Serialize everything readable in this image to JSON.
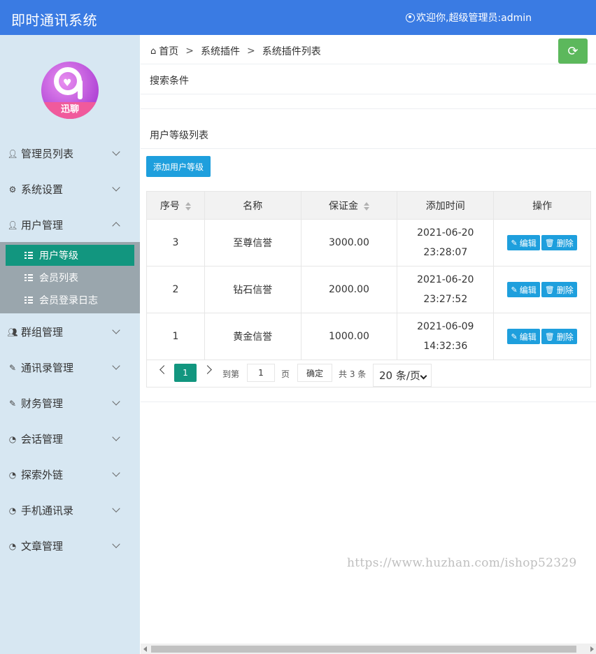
{
  "header": {
    "title": "即时通讯系统",
    "welcome": "欢迎你,超级管理员:admin"
  },
  "logo": {
    "text": "迅聊"
  },
  "sidebar": {
    "items": [
      {
        "label": "管理员列表",
        "icon": "user-icon"
      },
      {
        "label": "系统设置",
        "icon": "gear-icon"
      },
      {
        "label": "用户管理",
        "icon": "user-icon"
      },
      {
        "label": "群组管理",
        "icon": "users-icon"
      },
      {
        "label": "通讯录管理",
        "icon": "edit-icon"
      },
      {
        "label": "财务管理",
        "icon": "edit-icon"
      },
      {
        "label": "会话管理",
        "icon": "chat-icon"
      },
      {
        "label": "探索外链",
        "icon": "chat-icon"
      },
      {
        "label": "手机通讯录",
        "icon": "chat-icon"
      },
      {
        "label": "文章管理",
        "icon": "chat-icon"
      }
    ],
    "submenu": [
      {
        "label": "用户等级"
      },
      {
        "label": "会员列表"
      },
      {
        "label": "会员登录日志"
      }
    ]
  },
  "breadcrumb": {
    "home": "首页",
    "level1": "系统插件",
    "level2": "系统插件列表",
    "sep": ">"
  },
  "search_title": "搜索条件",
  "list_title": "用户等级列表",
  "add_button": "添加用户等级",
  "table": {
    "headers": [
      "序号",
      "名称",
      "保证金",
      "添加时间",
      "操作"
    ],
    "rows": [
      {
        "id": "3",
        "name": "至尊信誉",
        "deposit": "3000.00",
        "date": "2021-06-20",
        "time": "23:28:07"
      },
      {
        "id": "2",
        "name": "钻石信誉",
        "deposit": "2000.00",
        "date": "2021-06-20",
        "time": "23:27:52"
      },
      {
        "id": "1",
        "name": "黄金信誉",
        "deposit": "1000.00",
        "date": "2021-06-09",
        "time": "14:32:36"
      }
    ],
    "edit_label": "编辑",
    "delete_label": "删除"
  },
  "pager": {
    "current": "1",
    "goto_label": "到第",
    "page_value": "1",
    "page_unit": "页",
    "confirm": "确定",
    "total": "共 3 条",
    "page_size": "20 条/页"
  },
  "watermark": "https://www.huzhan.com/ishop52329"
}
